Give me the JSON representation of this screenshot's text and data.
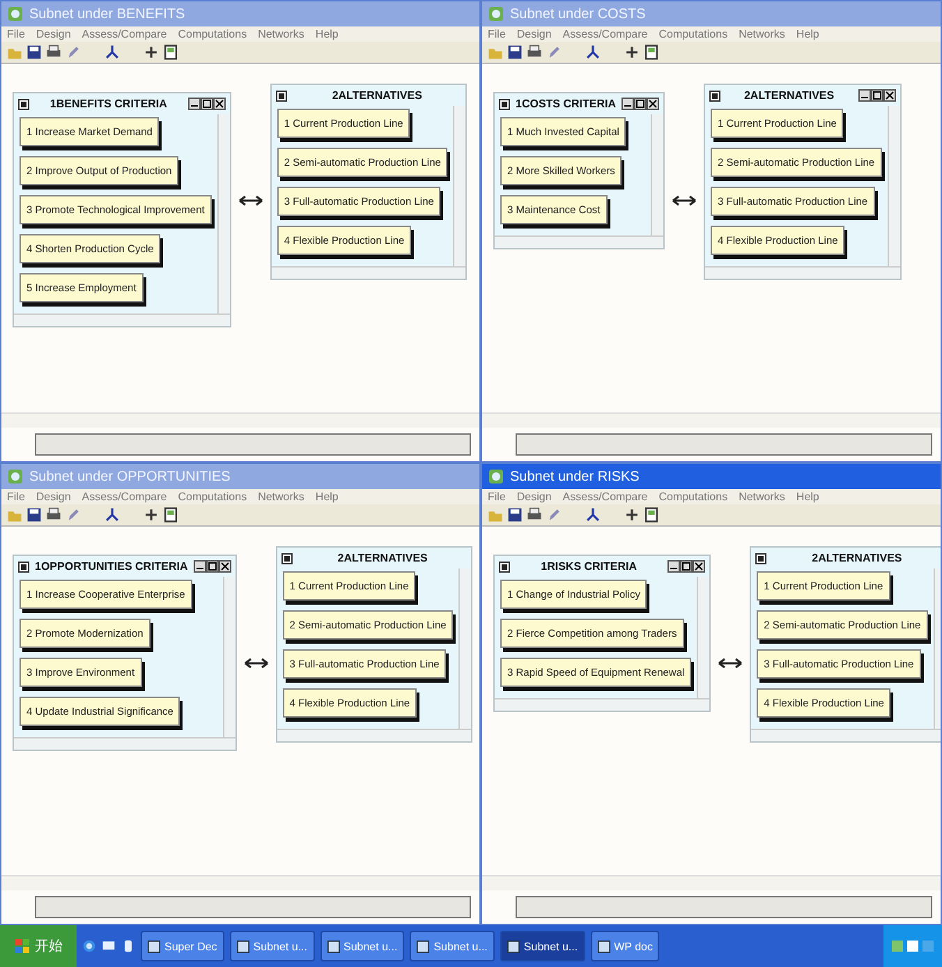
{
  "windows": [
    {
      "title": "Subnet under BENEFITS",
      "active": false,
      "menu": [
        "File",
        "Design",
        "Assess/Compare",
        "Computations",
        "Networks",
        "Help"
      ],
      "clusters": [
        {
          "title": "1BENEFITS CRITERIA",
          "controls": true,
          "nodes": [
            "1 Increase Market Demand",
            "2 Improve Output of Production",
            "3 Promote Technological Improvement",
            "4 Shorten Production Cycle",
            "5 Increase Employment"
          ]
        },
        {
          "title": "2ALTERNATIVES",
          "controls": false,
          "nodes": [
            "1 Current Production Line",
            "2 Semi-automatic Production Line",
            "3 Full-automatic Production Line",
            "4 Flexible Production Line"
          ]
        }
      ]
    },
    {
      "title": "Subnet under COSTS",
      "active": false,
      "menu": [
        "File",
        "Design",
        "Assess/Compare",
        "Computations",
        "Networks",
        "Help"
      ],
      "clusters": [
        {
          "title": "1COSTS CRITERIA",
          "controls": true,
          "nodes": [
            "1 Much Invested Capital",
            "2 More Skilled Workers",
            "3 Maintenance Cost"
          ]
        },
        {
          "title": "2ALTERNATIVES",
          "controls": true,
          "nodes": [
            "1 Current Production Line",
            "2 Semi-automatic Production Line",
            "3 Full-automatic Production Line",
            "4 Flexible Production Line"
          ]
        }
      ]
    },
    {
      "title": "Subnet under OPPORTUNITIES",
      "active": false,
      "menu": [
        "File",
        "Design",
        "Assess/Compare",
        "Computations",
        "Networks",
        "Help"
      ],
      "clusters": [
        {
          "title": "1OPPORTUNITIES CRITERIA",
          "controls": true,
          "nodes": [
            "1 Increase Cooperative Enterprise",
            "2 Promote Modernization",
            "3 Improve Environment",
            "4 Update Industrial Significance"
          ]
        },
        {
          "title": "2ALTERNATIVES",
          "controls": false,
          "nodes": [
            "1 Current Production Line",
            "2 Semi-automatic Production Line",
            "3 Full-automatic Production Line",
            "4 Flexible Production Line"
          ]
        }
      ]
    },
    {
      "title": "Subnet under RISKS",
      "active": true,
      "menu": [
        "File",
        "Design",
        "Assess/Compare",
        "Computations",
        "Networks",
        "Help"
      ],
      "clusters": [
        {
          "title": "1RISKS CRITERIA",
          "controls": true,
          "nodes": [
            "1 Change of Industrial Policy",
            "2 Fierce Competition among Traders",
            "3 Rapid Speed of Equipment Renewal"
          ]
        },
        {
          "title": "2ALTERNATIVES",
          "controls": false,
          "nodes": [
            "1 Current Production Line",
            "2 Semi-automatic Production Line",
            "3 Full-automatic Production Line",
            "4 Flexible Production Line"
          ]
        }
      ]
    }
  ],
  "taskbar": {
    "start": "开始",
    "tasks": [
      {
        "label": "Super Dec",
        "selected": false
      },
      {
        "label": "Subnet u...",
        "selected": false
      },
      {
        "label": "Subnet u...",
        "selected": false
      },
      {
        "label": "Subnet u...",
        "selected": false
      },
      {
        "label": "Subnet u...",
        "selected": true
      },
      {
        "label": "WP doc",
        "selected": false
      }
    ]
  }
}
